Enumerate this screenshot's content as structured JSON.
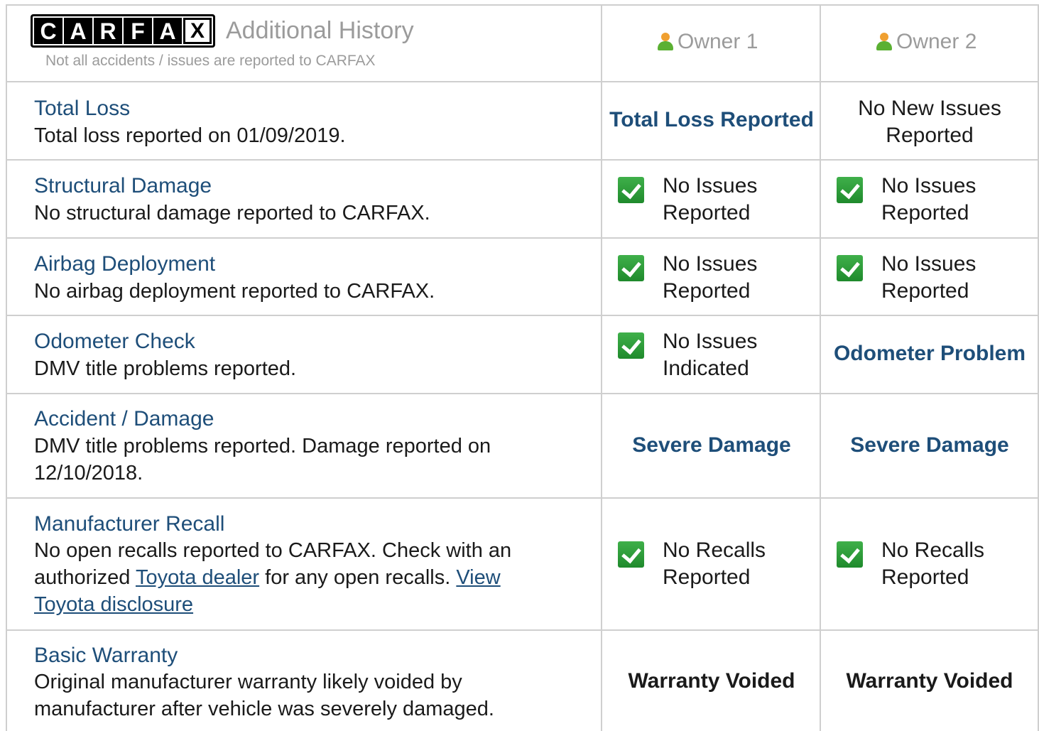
{
  "header": {
    "logo_letters": [
      "C",
      "A",
      "R",
      "F",
      "A",
      "X"
    ],
    "title": "Additional History",
    "subtitle": "Not all accidents / issues are reported to CARFAX",
    "owners": [
      "Owner 1",
      "Owner 2"
    ]
  },
  "rows": [
    {
      "title": "Total Loss",
      "desc": "Total loss reported on 01/09/2019.",
      "owner1": {
        "text": "Total Loss Reported"
      },
      "owner2": {
        "line1": "No New Issues",
        "line2": "Reported"
      }
    },
    {
      "title": "Structural Damage",
      "desc": "No structural damage reported to CARFAX.",
      "owner1": {
        "line1": "No Issues",
        "line2": "Reported"
      },
      "owner2": {
        "line1": "No Issues",
        "line2": "Reported"
      }
    },
    {
      "title": "Airbag Deployment",
      "desc": "No airbag deployment reported to CARFAX.",
      "owner1": {
        "line1": "No Issues",
        "line2": "Reported"
      },
      "owner2": {
        "line1": "No Issues",
        "line2": "Reported"
      }
    },
    {
      "title": "Odometer Check",
      "desc": "DMV title problems reported.",
      "owner1": {
        "line1": "No Issues",
        "line2": "Indicated"
      },
      "owner2": {
        "text": "Odometer Problem"
      }
    },
    {
      "title": "Accident / Damage",
      "desc_line1": "DMV title problems reported. Damage reported on",
      "desc_line2": "12/10/2018.",
      "owner1": {
        "text": "Severe Damage"
      },
      "owner2": {
        "text": "Severe Damage"
      }
    },
    {
      "title": "Manufacturer Recall",
      "desc_line1": "No open recalls reported to CARFAX. Check with an",
      "desc_pre_link": "authorized ",
      "dealer_link": "Toyota dealer",
      "desc_mid": " for any open recalls. ",
      "disclosure_link_1": "View",
      "disclosure_link_2": "Toyota disclosure",
      "owner1": {
        "line1": "No Recalls",
        "line2": "Reported"
      },
      "owner2": {
        "line1": "No Recalls",
        "line2": "Reported"
      }
    },
    {
      "title": "Basic Warranty",
      "desc_line1": "Original manufacturer warranty likely voided by",
      "desc_line2": "manufacturer after vehicle was severely damaged.",
      "owner1": {
        "text": "Warranty Voided"
      },
      "owner2": {
        "text": "Warranty Voided"
      }
    }
  ],
  "colors": {
    "link_blue": "#1e4e79",
    "check_green": "#2e9e3b",
    "muted_gray": "#9b9b9b",
    "grid": "#cfcfcf"
  }
}
